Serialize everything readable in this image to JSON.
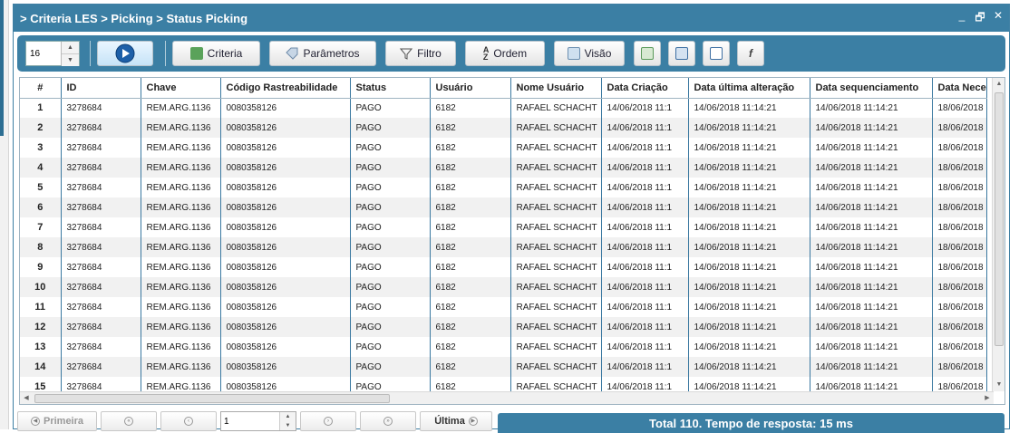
{
  "window": {
    "title": "> Criteria LES > Picking > Status Picking",
    "minimize": "_",
    "restore": "🗗",
    "close": "✕"
  },
  "toolbar": {
    "rows_value": "16",
    "criteria_label": "Criteria",
    "parametros_label": "Parâmetros",
    "filtro_label": "Filtro",
    "ordem_label": "Ordem",
    "visao_label": "Visão"
  },
  "grid": {
    "columns": [
      "#",
      "ID",
      "Chave",
      "Código Rastreabilidade",
      "Status",
      "Usuário",
      "Nome Usuário",
      "Data Criação",
      "Data última alteração",
      "Data sequenciamento",
      "Data Nece"
    ],
    "rows": [
      [
        "1",
        "3278684",
        "REM.ARG.1136",
        "0080358126",
        "PAGO",
        "6182",
        "RAFAEL SCHACHT",
        "14/06/2018 11:1",
        "14/06/2018 11:14:21",
        "14/06/2018 11:14:21",
        "18/06/2018"
      ],
      [
        "2",
        "3278684",
        "REM.ARG.1136",
        "0080358126",
        "PAGO",
        "6182",
        "RAFAEL SCHACHT",
        "14/06/2018 11:1",
        "14/06/2018 11:14:21",
        "14/06/2018 11:14:21",
        "18/06/2018"
      ],
      [
        "3",
        "3278684",
        "REM.ARG.1136",
        "0080358126",
        "PAGO",
        "6182",
        "RAFAEL SCHACHT",
        "14/06/2018 11:1",
        "14/06/2018 11:14:21",
        "14/06/2018 11:14:21",
        "18/06/2018"
      ],
      [
        "4",
        "3278684",
        "REM.ARG.1136",
        "0080358126",
        "PAGO",
        "6182",
        "RAFAEL SCHACHT",
        "14/06/2018 11:1",
        "14/06/2018 11:14:21",
        "14/06/2018 11:14:21",
        "18/06/2018"
      ],
      [
        "5",
        "3278684",
        "REM.ARG.1136",
        "0080358126",
        "PAGO",
        "6182",
        "RAFAEL SCHACHT",
        "14/06/2018 11:1",
        "14/06/2018 11:14:21",
        "14/06/2018 11:14:21",
        "18/06/2018"
      ],
      [
        "6",
        "3278684",
        "REM.ARG.1136",
        "0080358126",
        "PAGO",
        "6182",
        "RAFAEL SCHACHT",
        "14/06/2018 11:1",
        "14/06/2018 11:14:21",
        "14/06/2018 11:14:21",
        "18/06/2018"
      ],
      [
        "7",
        "3278684",
        "REM.ARG.1136",
        "0080358126",
        "PAGO",
        "6182",
        "RAFAEL SCHACHT",
        "14/06/2018 11:1",
        "14/06/2018 11:14:21",
        "14/06/2018 11:14:21",
        "18/06/2018"
      ],
      [
        "8",
        "3278684",
        "REM.ARG.1136",
        "0080358126",
        "PAGO",
        "6182",
        "RAFAEL SCHACHT",
        "14/06/2018 11:1",
        "14/06/2018 11:14:21",
        "14/06/2018 11:14:21",
        "18/06/2018"
      ],
      [
        "9",
        "3278684",
        "REM.ARG.1136",
        "0080358126",
        "PAGO",
        "6182",
        "RAFAEL SCHACHT",
        "14/06/2018 11:1",
        "14/06/2018 11:14:21",
        "14/06/2018 11:14:21",
        "18/06/2018"
      ],
      [
        "10",
        "3278684",
        "REM.ARG.1136",
        "0080358126",
        "PAGO",
        "6182",
        "RAFAEL SCHACHT",
        "14/06/2018 11:1",
        "14/06/2018 11:14:21",
        "14/06/2018 11:14:21",
        "18/06/2018"
      ],
      [
        "11",
        "3278684",
        "REM.ARG.1136",
        "0080358126",
        "PAGO",
        "6182",
        "RAFAEL SCHACHT",
        "14/06/2018 11:1",
        "14/06/2018 11:14:21",
        "14/06/2018 11:14:21",
        "18/06/2018"
      ],
      [
        "12",
        "3278684",
        "REM.ARG.1136",
        "0080358126",
        "PAGO",
        "6182",
        "RAFAEL SCHACHT",
        "14/06/2018 11:1",
        "14/06/2018 11:14:21",
        "14/06/2018 11:14:21",
        "18/06/2018"
      ],
      [
        "13",
        "3278684",
        "REM.ARG.1136",
        "0080358126",
        "PAGO",
        "6182",
        "RAFAEL SCHACHT",
        "14/06/2018 11:1",
        "14/06/2018 11:14:21",
        "14/06/2018 11:14:21",
        "18/06/2018"
      ],
      [
        "14",
        "3278684",
        "REM.ARG.1136",
        "0080358126",
        "PAGO",
        "6182",
        "RAFAEL SCHACHT",
        "14/06/2018 11:1",
        "14/06/2018 11:14:21",
        "14/06/2018 11:14:21",
        "18/06/2018"
      ],
      [
        "15",
        "3278684",
        "REM.ARG.1136",
        "0080358126",
        "PAGO",
        "6182",
        "RAFAEL SCHACHT",
        "14/06/2018 11:1",
        "14/06/2018 11:14:21",
        "14/06/2018 11:14:21",
        "18/06/2018"
      ]
    ]
  },
  "pager": {
    "first_label": "Primeira",
    "page_value": "1",
    "last_label": "Última"
  },
  "footer": {
    "total_text": "Total 110. Tempo de resposta: 15 ms"
  },
  "colors": {
    "accent": "#3b7fa4",
    "grid_line": "#3a78a0"
  }
}
